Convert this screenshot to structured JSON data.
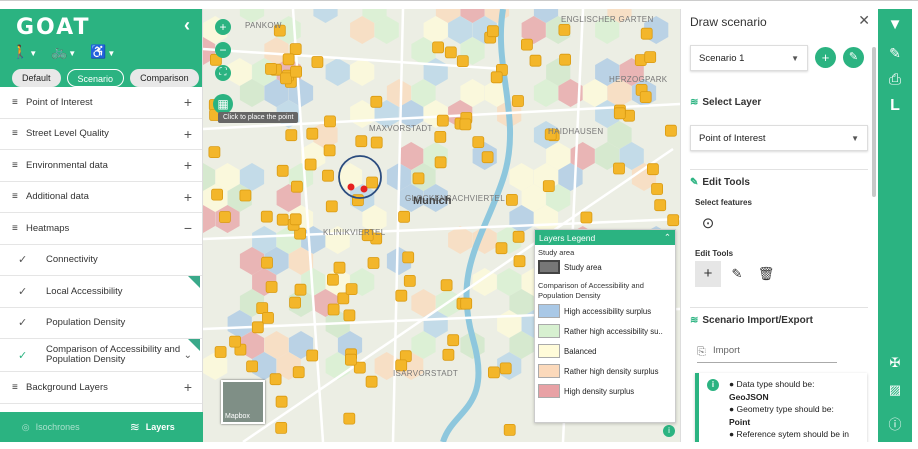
{
  "brand": {
    "logo": "GOAT",
    "collapse_icon": "chevron-left-icon"
  },
  "modes": [
    {
      "icon": "walking-icon",
      "glyph": "🚶"
    },
    {
      "icon": "bicycle-icon",
      "glyph": "🚲"
    },
    {
      "icon": "wheelchair-icon",
      "glyph": "♿"
    }
  ],
  "scenario_tabs": [
    "Default",
    "Scenario",
    "Comparison"
  ],
  "active_scenario_tab": "Scenario",
  "layer_groups": [
    {
      "label": "Point of Interest",
      "action": "+"
    },
    {
      "label": "Street Level Quality",
      "action": "+"
    },
    {
      "label": "Environmental data",
      "action": "+"
    },
    {
      "label": "Additional data",
      "action": "+"
    },
    {
      "label": "Heatmaps",
      "action": "−"
    }
  ],
  "heatmaps": [
    {
      "label": "Connectivity",
      "checked": false
    },
    {
      "label": "Local Accessibility",
      "checked": false
    },
    {
      "label": "Population Density",
      "checked": false
    },
    {
      "label": "Comparison of Accessibility and Population Density",
      "checked": true
    }
  ],
  "background_layers": {
    "label": "Background Layers",
    "action": "+"
  },
  "bottom_tabs": [
    {
      "label": "Isochrones",
      "active": false
    },
    {
      "label": "Layers",
      "active": true
    }
  ],
  "map": {
    "tooltip": "Click to place the point",
    "city": "Munich",
    "minimap_label": "Mapbox",
    "places": [
      "PANKOW",
      "MAXVORSTADT",
      "GLOCKENBACHVIERTEL",
      "ISARVORSTADT",
      "HAIDHAUSEN",
      "KLINIKVIERTEL",
      "HERZOGPARK",
      "ENGLISCHER GARTEN"
    ]
  },
  "legend": {
    "title": "Layers Legend",
    "study_area_heading": "Study area",
    "study_area_label": "Study area",
    "comparison_heading": "Comparison of Accessibility and Population Density",
    "items": [
      {
        "label": "High accessibility surplus",
        "color": "#a9c8e6"
      },
      {
        "label": "Rather high accessibility su..",
        "color": "#d7f0d0"
      },
      {
        "label": "Balanced",
        "color": "#fffbd9"
      },
      {
        "label": "Rather high density surplus",
        "color": "#fbd9bb"
      },
      {
        "label": "High density surplus",
        "color": "#e8a1a5"
      }
    ]
  },
  "draw_scenario": {
    "title": "Draw scenario",
    "scenario_select": "Scenario 1",
    "select_layer_heading": "Select Layer",
    "layer_select": "Point of Interest",
    "edit_tools_heading": "Edit Tools",
    "select_features_label": "Select features",
    "edit_tools_label": "Edit Tools",
    "import_export_heading": "Scenario Import/Export",
    "import_placeholder": "Import",
    "info_lines": [
      "● Data type should be:",
      "GeoJSON",
      "● Geometry type should be:",
      "Point",
      "● Reference sytem should be in"
    ]
  },
  "colors": {
    "accent": "#2bb381",
    "poi": "#f3b62a"
  }
}
